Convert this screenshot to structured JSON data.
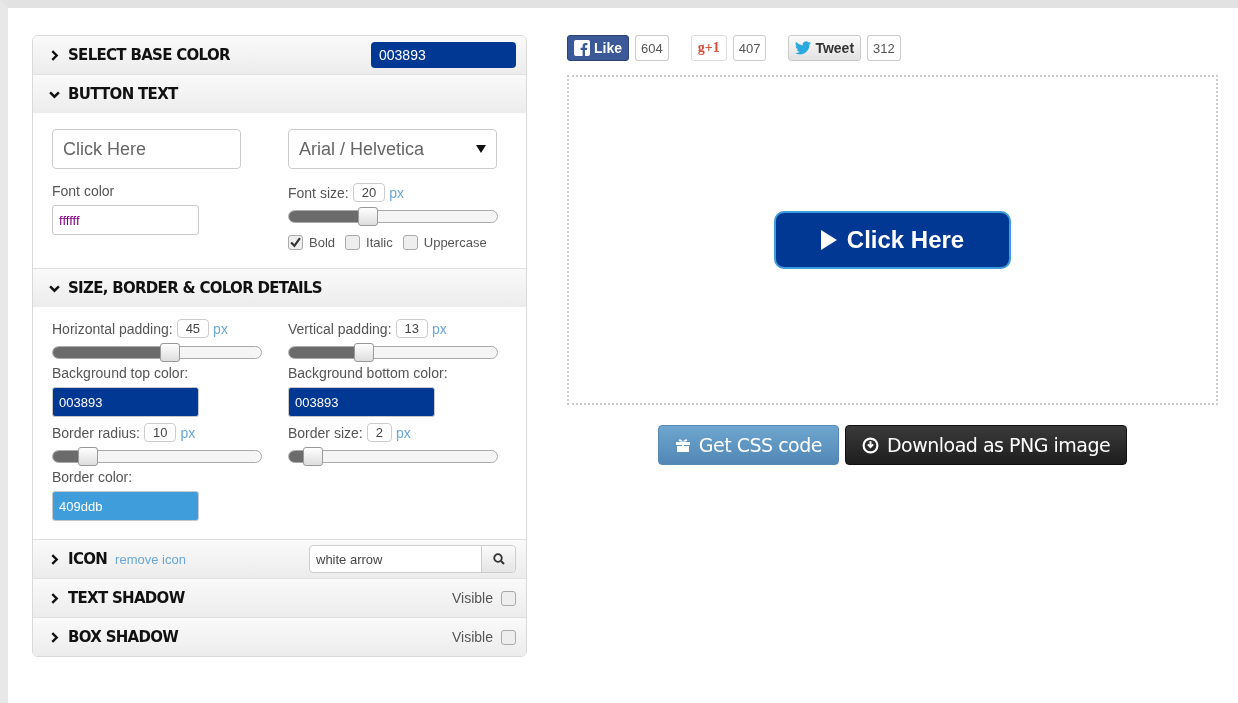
{
  "base_color": {
    "title": "SELECT BASE COLOR",
    "expanded": false,
    "value": "003893"
  },
  "button_text": {
    "title": "BUTTON TEXT",
    "expanded": true,
    "text_value": "Click Here",
    "font": "Arial / Helvetica",
    "font_color_label": "Font color",
    "font_color": "ffffff",
    "font_size": {
      "label": "Font size:",
      "value": "20",
      "unit": "px",
      "level": 0.35
    },
    "styles": [
      {
        "label": "Bold",
        "checked": true
      },
      {
        "label": "Italic",
        "checked": false
      },
      {
        "label": "Uppercase",
        "checked": false
      }
    ]
  },
  "details": {
    "title": "SIZE, BORDER & COLOR DETAILS",
    "expanded": true,
    "fields": [
      {
        "kind": "slider",
        "label": "Horizontal padding:",
        "value": "45",
        "unit": "px",
        "level": 0.56
      },
      {
        "kind": "slider",
        "label": "Vertical padding:",
        "value": "13",
        "unit": "px",
        "level": 0.33
      },
      {
        "kind": "color",
        "label": "Background top color:",
        "value": "003893"
      },
      {
        "kind": "color",
        "label": "Background bottom color:",
        "value": "003893"
      },
      {
        "kind": "slider",
        "label": "Border radius:",
        "value": "10",
        "unit": "px",
        "level": 0.11
      },
      {
        "kind": "slider",
        "label": "Border size:",
        "value": "2",
        "unit": "px",
        "level": 0.05
      },
      {
        "kind": "color",
        "label": "Border color:",
        "value": "409ddb"
      }
    ]
  },
  "icon": {
    "title": "ICON",
    "expanded": false,
    "link": "remove icon",
    "search_value": "white arrow"
  },
  "shadows": [
    {
      "title": "TEXT SHADOW",
      "expanded": false,
      "visible_label": "Visible",
      "checked": false
    },
    {
      "title": "BOX SHADOW",
      "expanded": false,
      "visible_label": "Visible",
      "checked": false
    }
  ],
  "social": [
    {
      "kind": "facebook",
      "label": "Like",
      "count": "604"
    },
    {
      "kind": "google",
      "label": "g+1",
      "count": "407"
    },
    {
      "kind": "twitter",
      "label": "Tweet",
      "count": "312"
    }
  ],
  "preview": {
    "label": "Click Here"
  },
  "actions": [
    {
      "kind": "css",
      "label": "Get CSS code"
    },
    {
      "kind": "png",
      "label": "Download as PNG image"
    }
  ]
}
